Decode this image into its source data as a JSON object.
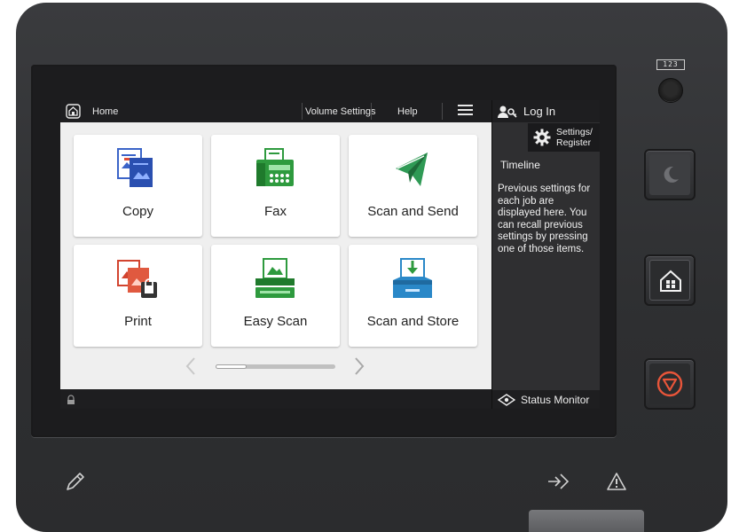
{
  "device": {
    "counter_badge": "123",
    "colors": {
      "body": "#2e2f31",
      "stop_accent": "#e8553a",
      "screen_bg": "#f2f2f2"
    }
  },
  "topbar": {
    "home_label": "Home",
    "volume_label": "Volume Settings",
    "help_label": "Help",
    "menu_icon": "hamburger-menu-icon"
  },
  "tiles": [
    {
      "label": "Copy",
      "icon": "copy-icon"
    },
    {
      "label": "Fax",
      "icon": "fax-icon"
    },
    {
      "label": "Scan and Send",
      "icon": "scan-send-icon"
    },
    {
      "label": "Print",
      "icon": "print-icon"
    },
    {
      "label": "Easy Scan",
      "icon": "easy-scan-icon"
    },
    {
      "label": "Scan and Store",
      "icon": "scan-store-icon"
    }
  ],
  "pager": {
    "current_page": 1,
    "total_pages": 3
  },
  "side_panel": {
    "login_label": "Log In",
    "settings_label_line1": "Settings/",
    "settings_label_line2": "Register",
    "timeline_title": "Timeline",
    "timeline_text": "Previous settings for each job are displayed here. You can recall previous settings by pressing one of those items.",
    "status_monitor_label": "Status Monitor"
  },
  "hardware_buttons": [
    "energy-saver-button",
    "home-button",
    "stop-button"
  ],
  "bottom_icons": [
    "pencil-icon",
    "data-indicator-icon",
    "error-indicator-icon"
  ]
}
